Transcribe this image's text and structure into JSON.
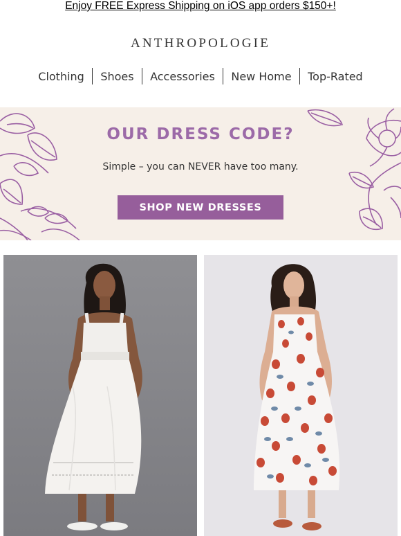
{
  "promo": {
    "text": "Enjoy FREE Express Shipping on iOS app orders $150+!"
  },
  "brand": {
    "logo_text": "ANTHROPOLOGIE"
  },
  "nav": {
    "items": [
      "Clothing",
      "Shoes",
      "Accessories",
      "New Home",
      "Top-Rated"
    ]
  },
  "banner": {
    "headline": "OUR DRESS CODE?",
    "subtext": "Simple – you can NEVER have too many.",
    "cta_label": "SHOP NEW DRESSES",
    "accent_color": "#965e9b",
    "background_color": "#f6efe8"
  },
  "products": [
    {
      "image": "white-midi-dress-photo",
      "background_color": "#88888c"
    },
    {
      "image": "strawberry-print-midi-dress-photo",
      "background_color": "#e7e5e9"
    }
  ]
}
